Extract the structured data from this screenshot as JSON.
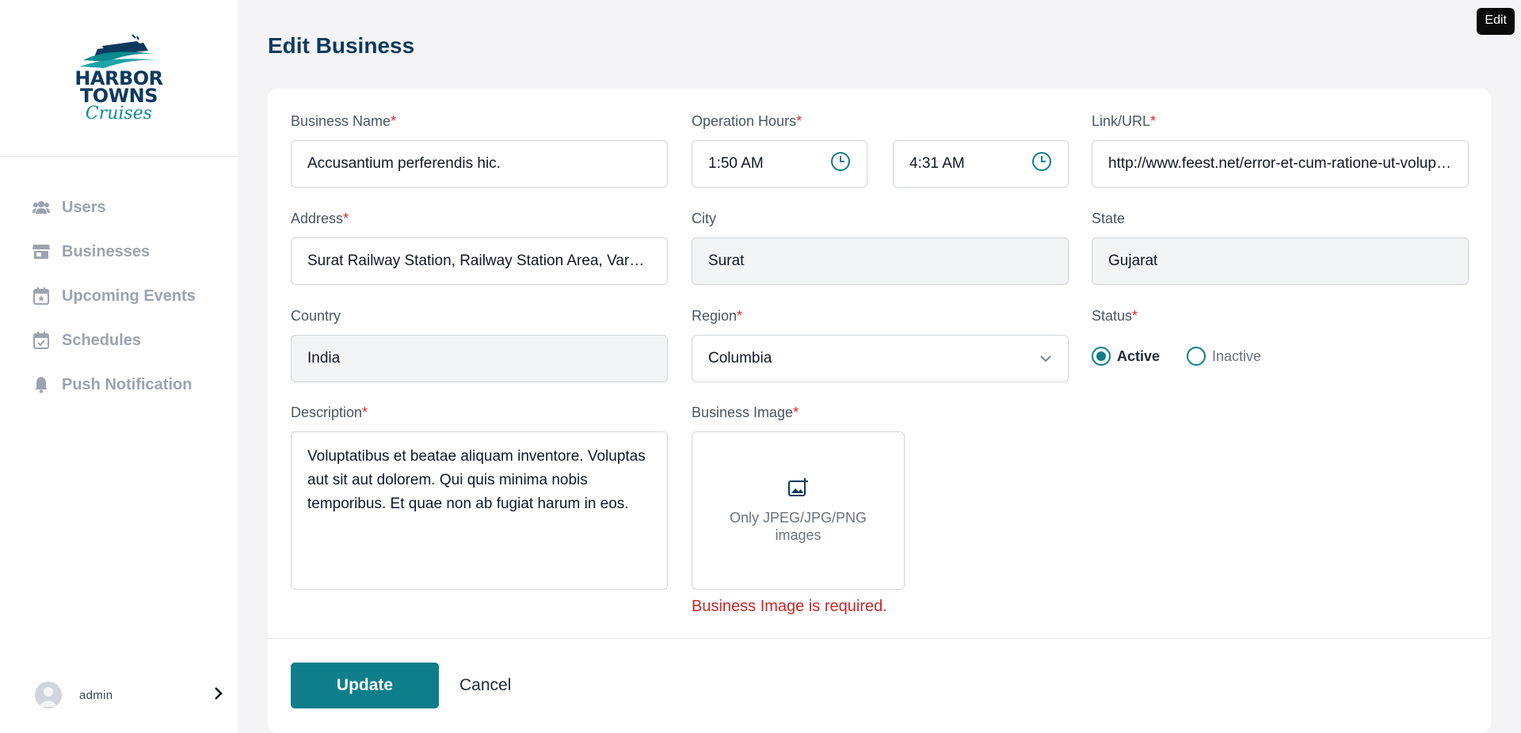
{
  "brand": {
    "line1": "HARBOR",
    "line2": "TOWNS",
    "script": "Cruises"
  },
  "sidebar": {
    "items": [
      {
        "label": "Users",
        "icon": "users-icon"
      },
      {
        "label": "Businesses",
        "icon": "store-icon"
      },
      {
        "label": "Upcoming Events",
        "icon": "calendar-star-icon"
      },
      {
        "label": "Schedules",
        "icon": "calendar-check-icon"
      },
      {
        "label": "Push Notification",
        "icon": "bell-icon"
      }
    ],
    "user": {
      "name": "admin",
      "icon": "chevron-right-icon"
    }
  },
  "page": {
    "title": "Edit Business",
    "tooltip": "Edit"
  },
  "form": {
    "business_name": {
      "label": "Business Name",
      "required": "*",
      "value": "Accusantium perferendis hic."
    },
    "operation_hours": {
      "label": "Operation Hours",
      "required": "*",
      "open": "1:50 AM",
      "close": "4:31 AM",
      "icon": "clock-icon"
    },
    "link_url": {
      "label": "Link/URL",
      "required": "*",
      "value": "http://www.feest.net/error-et-cum-ratione-ut-voluptas-facere"
    },
    "address": {
      "label": "Address",
      "required": "*",
      "value": "Surat Railway Station, Railway Station Area, Varachha, Surat"
    },
    "city": {
      "label": "City",
      "value": "Surat"
    },
    "state": {
      "label": "State",
      "value": "Gujarat"
    },
    "country": {
      "label": "Country",
      "value": "India"
    },
    "region": {
      "label": "Region",
      "required": "*",
      "value": "Columbia",
      "icon": "chevron-down-icon"
    },
    "status": {
      "label": "Status",
      "required": "*",
      "options": [
        "Active",
        "Inactive"
      ],
      "selected": "Active"
    },
    "description": {
      "label": "Description",
      "required": "*",
      "value": "Voluptatibus et beatae aliquam inventore. Voluptas aut sit aut dolorem. Qui quis minima nobis temporibus. Et quae non ab fugiat harum in eos."
    },
    "business_image": {
      "label": "Business Image",
      "required": "*",
      "hint": "Only JPEG/JPG/PNG images",
      "error": "Business Image is required.",
      "icon": "image-add-icon"
    }
  },
  "actions": {
    "update": "Update",
    "cancel": "Cancel"
  },
  "colors": {
    "accent": "#0d7e8a",
    "title": "#0c3a5e",
    "error": "#c62828",
    "required": "#dc2626"
  }
}
